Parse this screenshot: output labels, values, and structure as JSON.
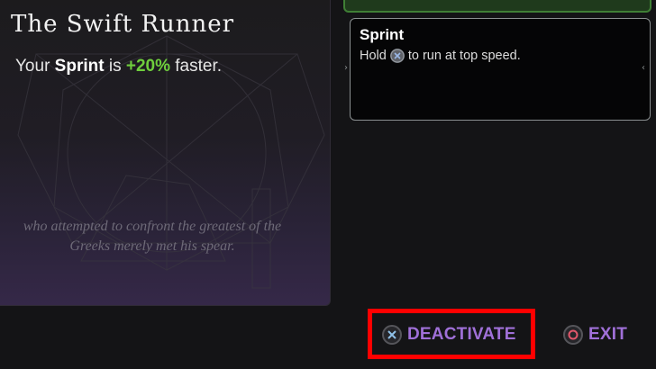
{
  "ability": {
    "title": "The Swift Runner",
    "effect_prefix": "Your",
    "effect_keyword": "Sprint",
    "effect_mid": "is",
    "effect_value": "+20%",
    "effect_suffix": "faster.",
    "flavor_line1": "who attempted to confront the greatest of the",
    "flavor_line2": "Greeks merely met his spear."
  },
  "skill": {
    "name": "Sprint",
    "desc_before": "Hold",
    "desc_button_icon": "cross-button-icon",
    "desc_after": "to run at top speed."
  },
  "actions": {
    "deactivate_label": "DEACTIVATE",
    "deactivate_icon": "cross-button-icon",
    "exit_label": "EXIT",
    "exit_icon": "circle-button-icon"
  },
  "colors": {
    "accent_purple": "#a070d8",
    "effect_green": "#6fce3d",
    "highlight_red": "#ff0000",
    "equipped_green": "#3f7f35"
  }
}
